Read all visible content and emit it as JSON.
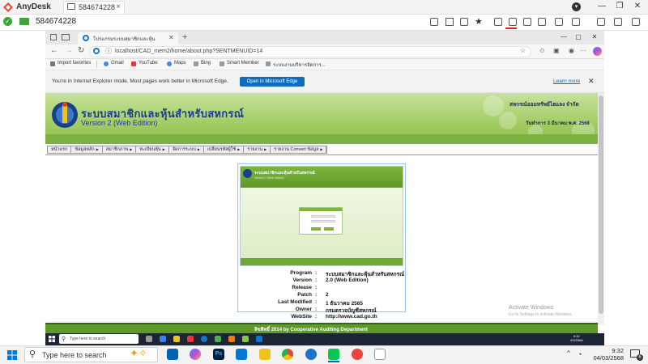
{
  "anydesk": {
    "app_name": "AnyDesk",
    "tab_id": "584674228",
    "address_id": "584674228"
  },
  "edge": {
    "tab_title": "โปรแกรมระบบสมาชิกและหุ้น",
    "url": "localhost/CAD_mem2/home/about.php?SENTMENUID=14",
    "favorites": [
      "Import favorites",
      "Gmail",
      "YouTube",
      "Maps",
      "Bing",
      "Smart Member",
      "ระบบงานบริหารจัดการ..."
    ],
    "ie_message": "You're in Internet Explorer mode. Most pages work better in Microsoft Edge.",
    "ie_button": "Open in Microsoft Edge",
    "learn_more": "Learn more"
  },
  "site": {
    "title": "ระบบสมาชิกและหุ้นสำหรับสหกรณ์",
    "version": "Version 2 (Web Edition)",
    "coop_name": "สหกรณ์ออมทรัพย์ไฮแลง จำกัด",
    "business_date": "วันทำการ 3 มีนาคม พ.ศ. 2568",
    "menu": [
      "หน้าแรก",
      "ข้อมูลหลัก",
      "สมาชิกภาพ",
      "ทะเบียนหุ้น",
      "จัดการระบบ",
      "เปลี่ยนรหัสผู้ใช้",
      "รายงาน",
      "รายงาน Convert ข้อมูล"
    ],
    "footer": "ลิขสิทธิ์ 2014 by Cooperative Auditing Department"
  },
  "about": {
    "shot_title": "ระบบสมาชิกและหุ้นสำหรับสหกรณ์",
    "shot_sub": "Version 2 (Web Edition)",
    "rows": [
      {
        "key": "Program",
        "value": "ระบบสมาชิกและหุ้นสำหรับสหกรณ์"
      },
      {
        "key": "Version",
        "value": "2.0 (Web Edition)"
      },
      {
        "key": "Release",
        "value": ""
      },
      {
        "key": "Patch",
        "value": "2"
      },
      {
        "key": "Last Modified",
        "value": "1 ธันวาคม 2565"
      },
      {
        "key": "Owner",
        "value": "กรมตรวจบัญชีสหกรณ์"
      },
      {
        "key": "WebSite",
        "value": "http://www.cad.go.th"
      }
    ]
  },
  "activation": {
    "title": "Activate Windows",
    "sub": "Go to Settings to activate Windows."
  },
  "remote_taskbar": {
    "search": "Type here to search",
    "time": "9:32",
    "date": "4/3/2568"
  },
  "taskbar": {
    "search": "Type here to search",
    "time": "9:32",
    "date": "04/03/2568",
    "notification_count": "6"
  },
  "colors": {
    "banner_green": "#8cbf4a",
    "footer_green": "#5d9a2a",
    "title_blue": "#1b3e8c",
    "edge_blue": "#0f6cbd",
    "anydesk_red": "#ef443b"
  }
}
